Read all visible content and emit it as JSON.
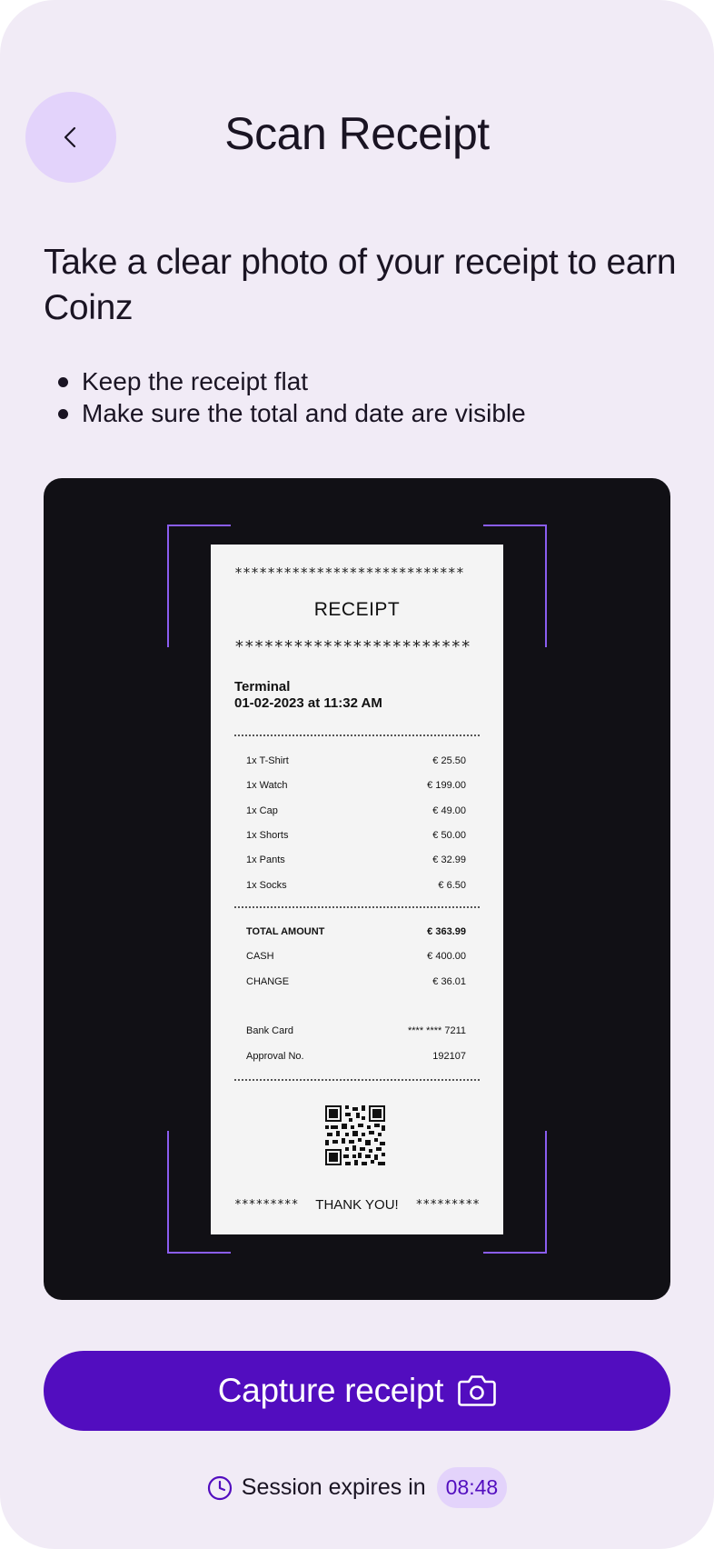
{
  "header": {
    "title": "Scan Receipt",
    "back_icon": "chevron-left-icon"
  },
  "instructions": {
    "headline": "Take a clear photo of your receipt to earn Coinz",
    "tips": [
      "Keep the receipt flat",
      "Make sure the total and date are visible"
    ]
  },
  "receipt": {
    "stars_top": "****************************",
    "title": "RECEIPT",
    "stars_mid": "************************",
    "terminal_label": "Terminal",
    "terminal_datetime": "01-02-2023 at 11:32 AM",
    "items": [
      {
        "name": "1x T-Shirt",
        "price": "€ 25.50"
      },
      {
        "name": "1x Watch",
        "price": "€ 199.00"
      },
      {
        "name": "1x Cap",
        "price": "€ 49.00"
      },
      {
        "name": "1x Shorts",
        "price": "€ 50.00"
      },
      {
        "name": "1x Pants",
        "price": "€ 32.99"
      },
      {
        "name": "1x Socks",
        "price": "€ 6.50"
      }
    ],
    "totals": [
      {
        "label": "TOTAL AMOUNT",
        "value": "€ 363.99"
      },
      {
        "label": "CASH",
        "value": "€ 400.00"
      },
      {
        "label": "CHANGE",
        "value": "€ 36.01"
      }
    ],
    "payment": [
      {
        "label": "Bank Card",
        "value": "**** **** 7211"
      },
      {
        "label": "Approval No.",
        "value": "192107"
      }
    ],
    "footer_stars_left": "*********",
    "footer_text": "THANK YOU!",
    "footer_stars_right": "*********"
  },
  "capture": {
    "label": "Capture receipt",
    "icon": "camera-icon"
  },
  "session": {
    "icon": "clock-icon",
    "label": "Session expires in",
    "timer": "08:48"
  },
  "colors": {
    "background": "#f1ebf6",
    "accent": "#520dbf",
    "accent_light": "#e3d3fb",
    "frame": "#8a5df0",
    "viewfinder": "#111015"
  }
}
